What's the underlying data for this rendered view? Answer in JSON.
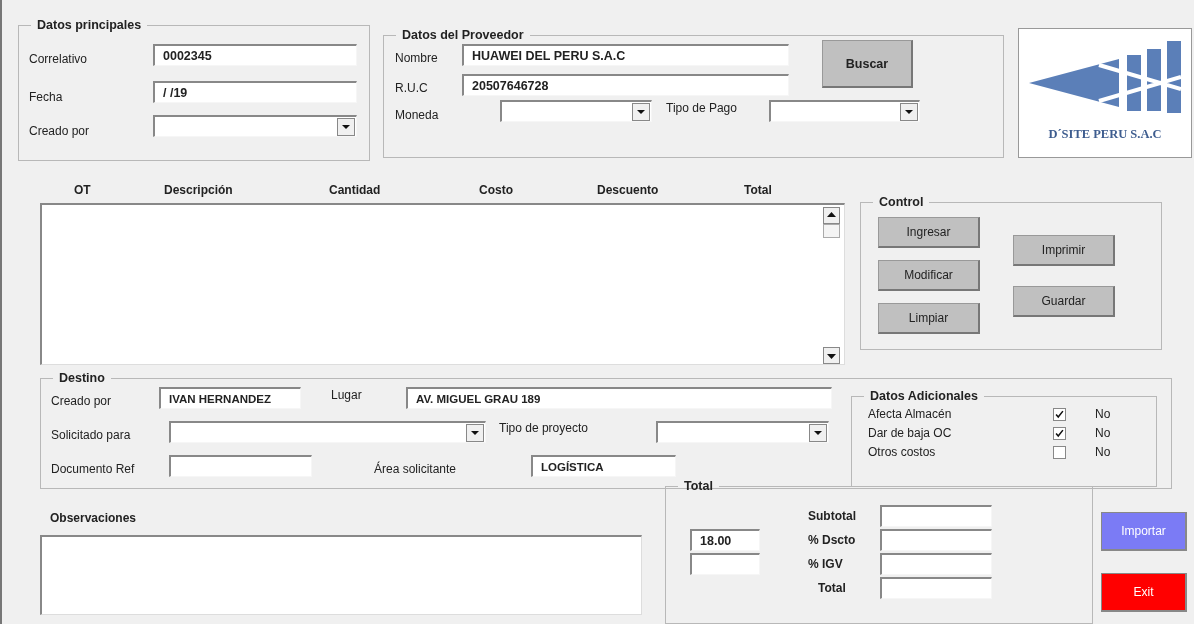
{
  "datos_principales": {
    "title": "Datos principales",
    "fields": [
      {
        "label": "Correlativo",
        "kind": "text",
        "value": "0002345"
      },
      {
        "label": "Fecha",
        "kind": "text",
        "value": "/ /19"
      },
      {
        "label": "Creado por",
        "kind": "dropdown"
      }
    ]
  },
  "datos_proveedor": {
    "title": "Datos del Proveedor",
    "nombre": {
      "label": "Nombre",
      "kind": "text",
      "value": "HUAWEI DEL PERU S.A.C"
    },
    "ruc": {
      "label": "R.U.C",
      "kind": "text",
      "value": "20507646728"
    },
    "moneda": {
      "label": "Moneda",
      "kind": "dropdown"
    },
    "tipo_pago": {
      "label": "Tipo de Pago",
      "kind": "dropdown"
    },
    "button": "Buscar"
  },
  "logo": {
    "text": "D´SITE PERU S.A.C"
  },
  "list": {
    "columns": [
      "OT",
      "Descripción",
      "Cantidad",
      "Costo",
      "Descuento",
      "Total"
    ]
  },
  "control": {
    "title": "Control",
    "buttons_left": [
      "Ingresar",
      "Modificar",
      "Limpiar"
    ],
    "buttons_right": [
      "Imprimir",
      "Guardar"
    ]
  },
  "destino": {
    "title": "Destino",
    "creado_por": {
      "label": "Creado por",
      "kind": "text",
      "value": "IVAN HERNANDEZ"
    },
    "lugar": {
      "label": "Lugar",
      "kind": "text",
      "value": "AV. MIGUEL GRAU 189"
    },
    "solicitado_para": {
      "label": "Solicitado para",
      "kind": "dropdown"
    },
    "tipo_proyecto": {
      "label": "Tipo de proyecto",
      "kind": "dropdown"
    },
    "documento_ref": {
      "label": "Documento Ref",
      "kind": "text"
    },
    "area_solicitante": {
      "label": "Área solicitante",
      "kind": "text",
      "value": "LOGÍSTICA"
    }
  },
  "datos_adicionales": {
    "title": "Datos Adicionales",
    "items": [
      {
        "label": "Afecta Almacén",
        "checked": true,
        "value": "No"
      },
      {
        "label": "Dar de baja OC",
        "checked": true,
        "value": "No"
      },
      {
        "label": "Otros costos",
        "checked": false,
        "value": "No"
      }
    ]
  },
  "observaciones": {
    "label": "Observaciones"
  },
  "total": {
    "title": "Total",
    "rows": [
      {
        "label": "Subtotal"
      },
      {
        "label": "% Dscto",
        "left_field": {
          "kind": "text",
          "value": "18.00"
        }
      },
      {
        "label": "% IGV",
        "left_field": {
          "kind": "text"
        }
      },
      {
        "label": "Total"
      }
    ]
  },
  "buttons": [
    {
      "label": "Importar",
      "color": "#7b7bf5"
    },
    {
      "label": "Exit",
      "color": "#ff0000"
    }
  ]
}
